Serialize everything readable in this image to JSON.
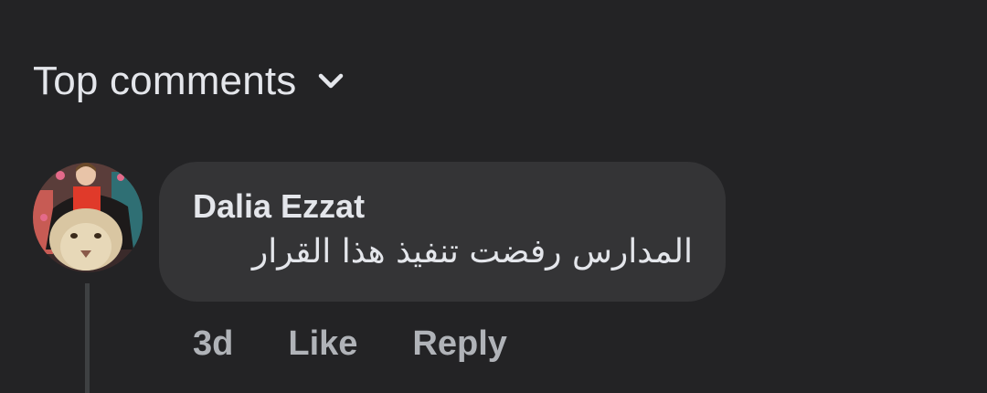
{
  "comments_header": {
    "sort_label": "Top comments",
    "sort_icon": "chevron-down-icon"
  },
  "comment": {
    "author": "Dalia Ezzat",
    "text": "المدارس رفضت تنفيذ هذا القرار",
    "time": "3d",
    "like_label": "Like",
    "reply_label": "Reply"
  },
  "colors": {
    "background": "#232325",
    "bubble": "#343436",
    "primary_text": "#e4e6eb",
    "secondary_text": "#b0b3b8",
    "thread_line": "#3e4042"
  }
}
